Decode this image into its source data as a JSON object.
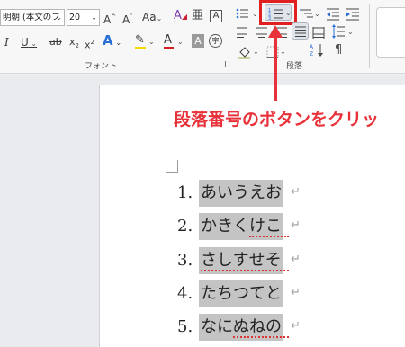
{
  "ribbon": {
    "font_name": "明朝 (本文のフ",
    "font_size": "20",
    "font_group_label": "フォント",
    "paragraph_group_label": "段落",
    "icons": {
      "grow_font": "A^",
      "shrink_font": "A˅",
      "change_case": "Aa",
      "clear_format": "A",
      "phonetic": "亜",
      "enclose": "A",
      "italic": "I",
      "underline": "U",
      "strike": "ab",
      "subscript": "x₂",
      "superscript": "x²",
      "text_effect": "A",
      "highlight": "✎",
      "font_color": "A",
      "char_shading": "A",
      "enclose_char": "字"
    },
    "colors": {
      "highlight": "#f5d800",
      "font_color": "#d42020",
      "selected_outline": "#e02020"
    }
  },
  "annotation": {
    "text": "段落番号のボタンをクリッ",
    "color": "#e8323a"
  },
  "document": {
    "items": [
      {
        "num": "1.",
        "text": "あいうえお"
      },
      {
        "num": "2.",
        "text": "かきくけこ"
      },
      {
        "num": "3.",
        "text": "さしすせそ"
      },
      {
        "num": "4.",
        "text": "たちつてと"
      },
      {
        "num": "5.",
        "text": "なにぬねの"
      }
    ],
    "paragraph_mark": "↵"
  }
}
